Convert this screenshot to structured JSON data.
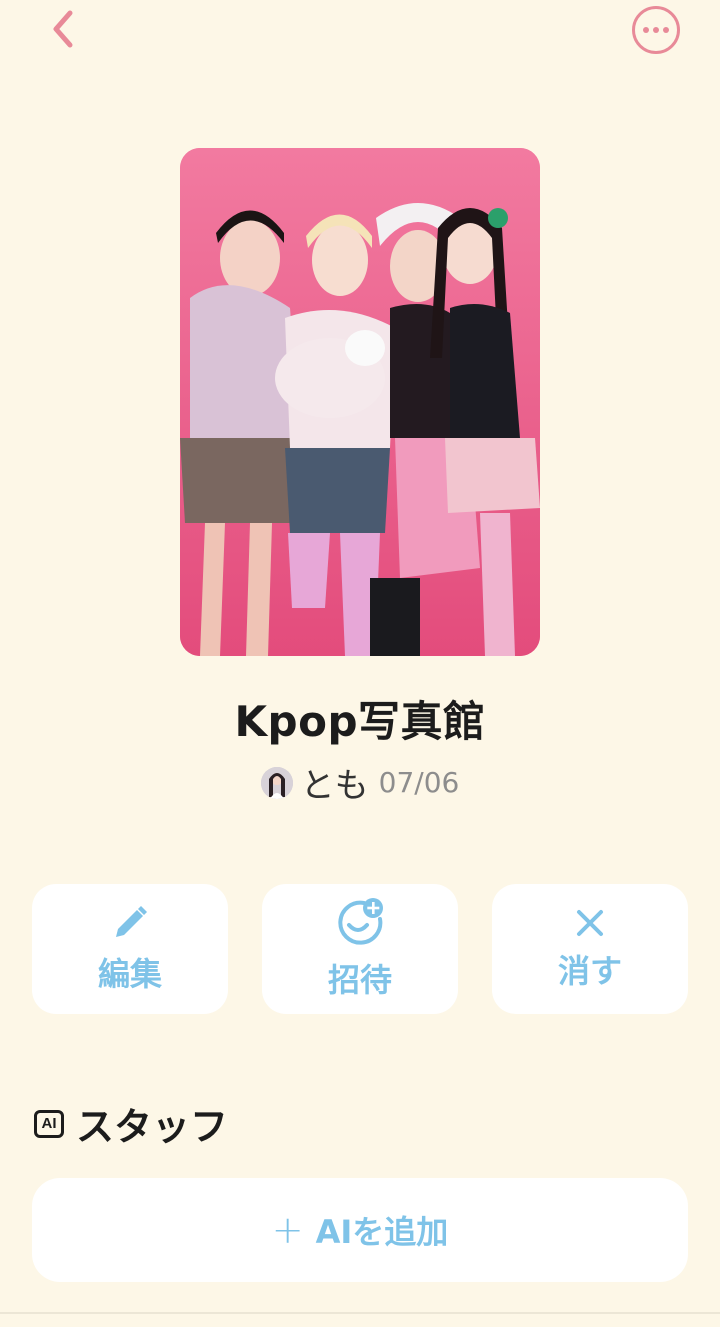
{
  "header": {
    "back_icon": "chevron-left-icon",
    "more_icon": "more-horizontal-icon",
    "accent_color": "#e88a98"
  },
  "album": {
    "title": "Kpop写真館",
    "owner": "とも",
    "date": "07/06",
    "cover_colors": [
      "#f0739a",
      "#e5527f"
    ]
  },
  "actions": [
    {
      "label": "編集",
      "icon": "pencil-icon"
    },
    {
      "label": "招待",
      "icon": "add-person-icon"
    },
    {
      "label": "消す",
      "icon": "close-icon"
    }
  ],
  "staff": {
    "badge": "AI",
    "title": "スタッフ",
    "add_label": "AIを追加",
    "add_icon": "plus-icon"
  },
  "colors": {
    "background": "#fdf7e7",
    "action_blue": "#7fc3e8",
    "card_bg": "#ffffff"
  }
}
